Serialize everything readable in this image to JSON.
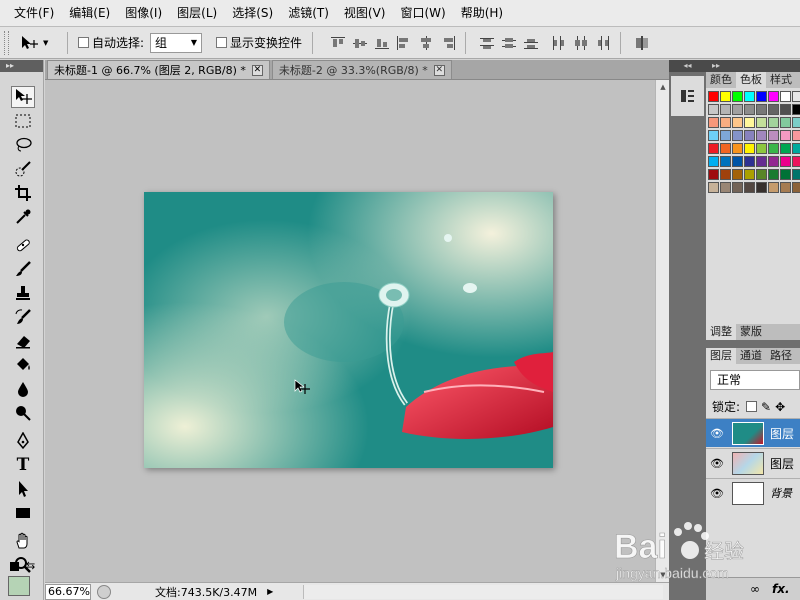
{
  "menu": {
    "items": [
      "文件(F)",
      "编辑(E)",
      "图像(I)",
      "图层(L)",
      "选择(S)",
      "滤镜(T)",
      "视图(V)",
      "窗口(W)",
      "帮助(H)"
    ]
  },
  "options": {
    "auto_select_label": "自动选择:",
    "auto_select_value": "组",
    "show_transform_label": "显示变换控件"
  },
  "tabs": [
    {
      "label": "未标题-1 @ 66.7% (图层 2, RGB/8) *"
    },
    {
      "label": "未标题-2 @ 33.3%(RGB/8) *"
    }
  ],
  "status": {
    "zoom": "66.67%",
    "doc_info": "文档:743.5K/3.47M"
  },
  "panels": {
    "top_tabs": [
      "颜色",
      "色板",
      "样式"
    ],
    "mid_tabs": [
      "调整",
      "蒙版"
    ],
    "layer_tabs": [
      "图层",
      "通道",
      "路径"
    ],
    "blend_mode": "正常",
    "lock_label": "锁定:",
    "layers": [
      {
        "name": "图层"
      },
      {
        "name": "图层"
      },
      {
        "name": "背景"
      }
    ],
    "footer_icons": "fx."
  },
  "watermark": {
    "brand": "Bai",
    "brand2": "du",
    "cn": "经验",
    "url": "jingyan.baidu.com"
  },
  "colors": {
    "selected_layer": "#3d80c4",
    "foreground_swatch": "#b5d3b5",
    "photo_teal": "#1f8c86"
  }
}
